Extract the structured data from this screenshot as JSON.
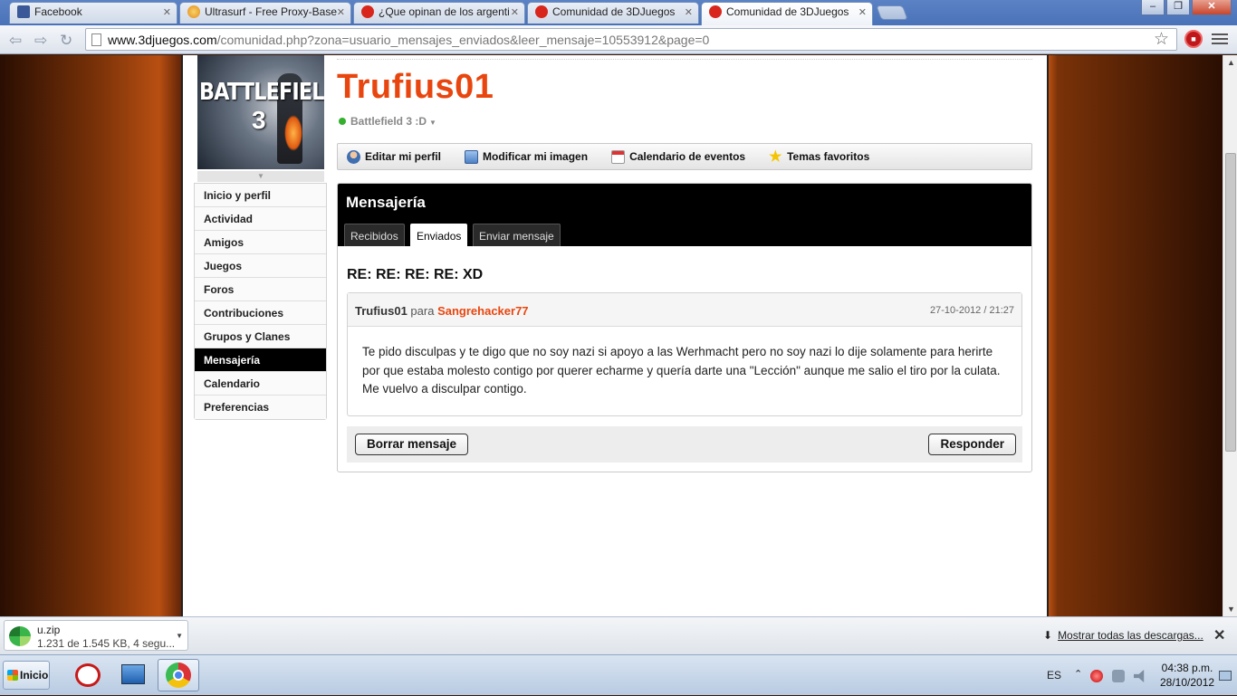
{
  "browser": {
    "tabs": [
      {
        "title": "Facebook",
        "favicon": "facebook-icon",
        "color": "#3b5998",
        "active": false
      },
      {
        "title": "Ultrasurf - Free Proxy-Base",
        "favicon": "ultrasurf-icon",
        "color": "#f2a62a",
        "active": false
      },
      {
        "title": "¿Que opinan de los argenti",
        "favicon": "3djuegos-icon",
        "color": "#d8261c",
        "active": false
      },
      {
        "title": "Comunidad de 3DJuegos",
        "favicon": "3djuegos-icon",
        "color": "#d8261c",
        "active": false
      },
      {
        "title": "Comunidad de 3DJuegos",
        "favicon": "3djuegos-icon",
        "color": "#d8261c",
        "active": true
      }
    ],
    "url_host": "www.3djuegos.com",
    "url_path": "/comunidad.php?zona=usuario_mensajes_enviados&leer_mensaje=10553912&page=0",
    "window_buttons": {
      "minimize": "–",
      "maximize": "❐",
      "close": "✕"
    }
  },
  "profile": {
    "game_cover": {
      "title": "BATTLEFIELD",
      "number": "3"
    },
    "username": "Trufius01",
    "status": "Battlefield 3 :D",
    "status_color": "#33b02d",
    "accent_color": "#e8460e",
    "actions": [
      {
        "label": "Editar mi perfil",
        "icon": "user-edit-icon"
      },
      {
        "label": "Modificar mi imagen",
        "icon": "image-icon"
      },
      {
        "label": "Calendario de eventos",
        "icon": "calendar-icon"
      },
      {
        "label": "Temas favoritos",
        "icon": "star-icon"
      }
    ]
  },
  "sidebar": {
    "items": [
      {
        "label": "Inicio y perfil",
        "active": false
      },
      {
        "label": "Actividad",
        "active": false
      },
      {
        "label": "Amigos",
        "active": false
      },
      {
        "label": "Juegos",
        "active": false
      },
      {
        "label": "Foros",
        "active": false
      },
      {
        "label": "Contribuciones",
        "active": false
      },
      {
        "label": "Grupos y Clanes",
        "active": false
      },
      {
        "label": "Mensajería",
        "active": true
      },
      {
        "label": "Calendario",
        "active": false
      },
      {
        "label": "Preferencias",
        "active": false
      }
    ]
  },
  "messaging": {
    "title": "Mensajería",
    "tabs": [
      {
        "label": "Recibidos",
        "active": false
      },
      {
        "label": "Enviados",
        "active": true
      },
      {
        "label": "Enviar mensaje",
        "active": false
      }
    ],
    "subject": "RE: RE: RE: RE: XD",
    "message": {
      "from": "Trufius01",
      "para": "para",
      "to": "Sangrehacker77",
      "date": "27-10-2012 / 21:27",
      "body": "Te pido disculpas y te digo que no soy nazi si apoyo a las Werhmacht pero no soy nazi lo dije solamente para herirte por que estaba molesto contigo por querer echarme y quería darte una \"Lección\" aunque me salio el tiro por la culata. Me vuelvo a disculpar contigo."
    },
    "delete_label": "Borrar mensaje",
    "reply_label": "Responder"
  },
  "downloads": {
    "file_name": "u.zip",
    "progress": "1.231 de 1.545 KB, 4 segu...",
    "show_all": "Mostrar todas las descargas...",
    "close": "✕"
  },
  "taskbar": {
    "start_label": "Inicio",
    "language": "ES",
    "time": "04:38 p.m.",
    "date": "28/10/2012"
  }
}
